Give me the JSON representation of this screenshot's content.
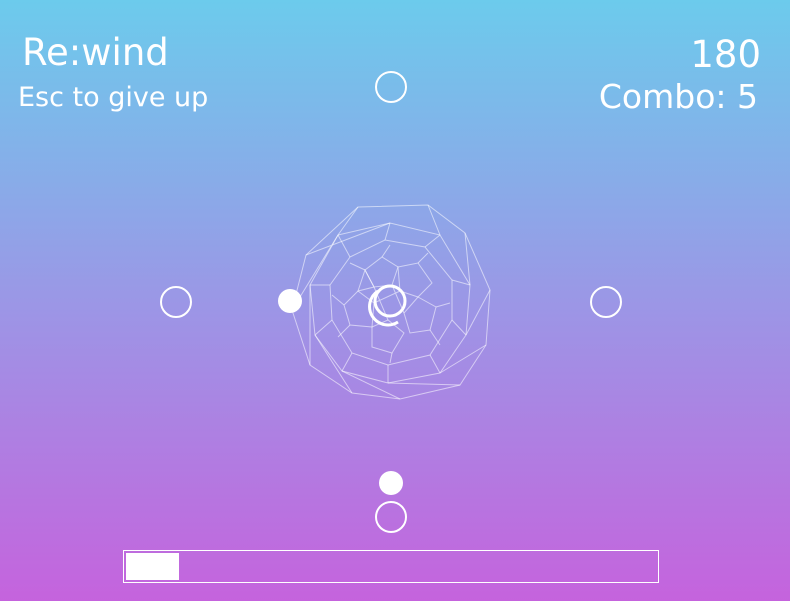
{
  "hud": {
    "title": "Re:wind",
    "hint": "Esc to give up",
    "score": "180",
    "combo": "Combo: 5"
  },
  "progress": {
    "fraction": 0.1
  },
  "icons": {
    "target_rings": "hollow-circle",
    "notes": "filled-circle",
    "center": "wireframe-geodesic-orb"
  },
  "colors": {
    "background_top": "#6ccbec",
    "background_mid": "#9b97e6",
    "background_bottom": "#c563dd",
    "foreground": "#ffffff"
  }
}
